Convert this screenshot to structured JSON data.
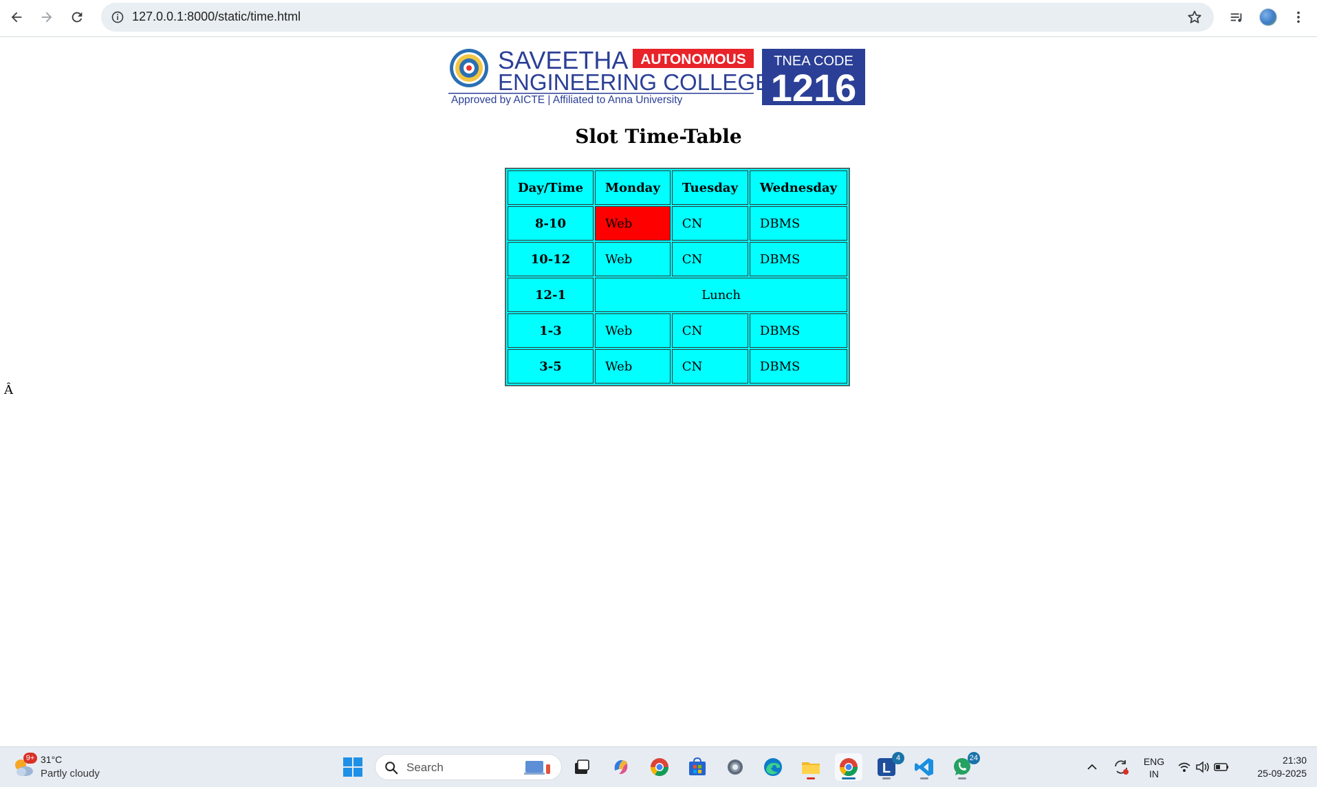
{
  "browser": {
    "url": "127.0.0.1:8000/static/time.html"
  },
  "logo": {
    "name_line1": "SAVEETHA",
    "badge": "AUTONOMOUS",
    "name_line2": "ENGINEERING COLLEGE",
    "tagline": "Approved by AICTE  |  Affiliated to Anna University",
    "code_label": "TNEA CODE",
    "code_value": "1216"
  },
  "page": {
    "title": "Slot Time-Table",
    "stray_char": "Â"
  },
  "timetable": {
    "headers": [
      "Day/Time",
      "Monday",
      "Tuesday",
      "Wednesday"
    ],
    "rows": [
      {
        "time": "8-10",
        "monday": "Web",
        "tuesday": "CN",
        "wednesday": "DBMS"
      },
      {
        "time": "10-12",
        "monday": "Web",
        "tuesday": "CN",
        "wednesday": "DBMS"
      },
      {
        "time": "12-1",
        "lunch": "Lunch"
      },
      {
        "time": "1-3",
        "monday": "Web",
        "tuesday": "CN",
        "wednesday": "DBMS"
      },
      {
        "time": "3-5",
        "monday": "Web",
        "tuesday": "CN",
        "wednesday": "DBMS"
      }
    ],
    "cell_color": "#00ffff",
    "highlight_color": "#ff0000"
  },
  "taskbar": {
    "weather": {
      "badge": "9+",
      "temp": "31°C",
      "condition": "Partly cloudy"
    },
    "search_label": "Search",
    "badges": {
      "app_l": "4",
      "whatsapp": "24"
    },
    "language": {
      "line1": "ENG",
      "line2": "IN"
    },
    "clock": {
      "time": "21:30",
      "date": "25-09-2025"
    }
  },
  "icons": [
    "back-icon",
    "forward-icon",
    "reload-icon",
    "site-info-icon",
    "bookmark-star-icon",
    "reading-list-icon",
    "profile-avatar",
    "menu-dots-icon",
    "windows-start-icon",
    "search-icon",
    "task-view-icon",
    "copilot-icon",
    "chrome-icon",
    "store-icon",
    "settings-icon",
    "edge-icon",
    "file-explorer-icon",
    "vscode-icon",
    "whatsapp-icon",
    "wifi-icon",
    "volume-icon",
    "battery-icon"
  ]
}
